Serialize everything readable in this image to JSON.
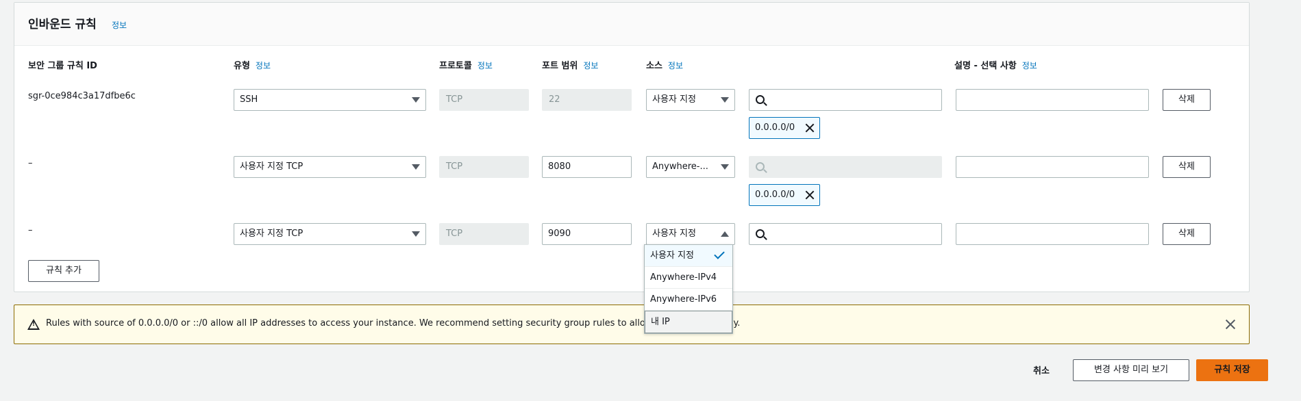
{
  "panel": {
    "title": "인바운드 규칙",
    "info": "정보"
  },
  "columns": {
    "rule_id": "보안 그룹 규칙 ID",
    "type": "유형",
    "type_info": "정보",
    "protocol": "프로토콜",
    "protocol_info": "정보",
    "port_range": "포트 범위",
    "port_range_info": "정보",
    "source": "소스",
    "source_info": "정보",
    "description": "설명 - 선택 사항",
    "description_info": "정보"
  },
  "rules": [
    {
      "id": "sgr-0ce984c3a17dfbe6c",
      "type": "SSH",
      "protocol": "TCP",
      "port": "22",
      "source": "사용자 지정",
      "cidr_token": "0.0.0.0/0",
      "delete": "삭제"
    },
    {
      "id": "–",
      "type": "사용자 지정 TCP",
      "protocol": "TCP",
      "port": "8080",
      "source": "Anywhere-...",
      "cidr_token": "0.0.0.0/0",
      "delete": "삭제"
    },
    {
      "id": "–",
      "type": "사용자 지정 TCP",
      "protocol": "TCP",
      "port": "9090",
      "source": "사용자 지정",
      "delete": "삭제"
    }
  ],
  "add_rule": "규칙 추가",
  "source_dropdown": {
    "options": [
      "사용자 지정",
      "Anywhere-IPv4",
      "Anywhere-IPv6",
      "내 IP"
    ],
    "selected": "사용자 지정"
  },
  "alert": {
    "text": "Rules with source of 0.0.0.0/0 or ::/0 allow all IP addresses to access your instance. We recommend setting security group rules to allow a                    P addresses only."
  },
  "footer": {
    "cancel": "취소",
    "preview": "변경 사항 미리 보기",
    "save": "규칙 저장"
  },
  "colors": {
    "accent": "#ec7211",
    "link": "#0073bb",
    "warning_border": "#8c6b00",
    "warning_bg": "#fffce9"
  }
}
